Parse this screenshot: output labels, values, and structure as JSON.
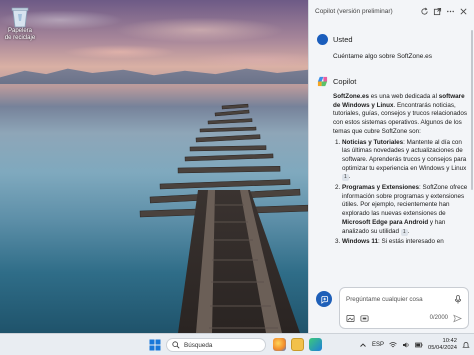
{
  "desktop": {
    "recycle_bin_label": "Papelera de reciclaje"
  },
  "copilot": {
    "header_title": "Copilot (versión preliminar)",
    "user": {
      "name": "Usted",
      "message": "Cuéntame algo sobre SoftZone.es"
    },
    "assistant": {
      "name": "Copilot",
      "intro_bold_1": "SoftZone.es",
      "intro_text_1": " es una web dedicada al ",
      "intro_bold_2": "software de Windows y Linux",
      "intro_text_2": ". Encontrarás noticias, tutoriales, guías, consejos y trucos relacionados con estos sistemas operativos. Algunos de los temas que cubre SoftZone son:",
      "items": [
        {
          "title": "Noticias y Tutoriales",
          "text": ": Mantente al día con las últimas novedades y actualizaciones de software. Aprenderás trucos y consejos para optimizar tu experiencia en Windows y Linux",
          "ref": "1",
          "tail": "."
        },
        {
          "title": "Programas y Extensiones",
          "text": ": SoftZone ofrece información sobre programas y extensiones útiles. Por ejemplo, recientemente han explorado las nuevas extensiones de ",
          "bold2": "Microsoft Edge para Android",
          "text2": " y han analizado su utilidad",
          "ref": "1",
          "tail": "."
        },
        {
          "title": "Windows 11",
          "text": ": Si estás interesado en"
        }
      ]
    },
    "composer": {
      "placeholder": "Pregúntame cualquier cosa",
      "counter": "0/2000"
    }
  },
  "taskbar": {
    "search_label": "Búsqueda",
    "language": "ESP",
    "time": "10:42",
    "date": "05/04/2024"
  },
  "colors": {
    "accent": "#1e5fb8",
    "pane_bg": "#f3f5f8",
    "taskbar_bg": "#e9edf2"
  }
}
